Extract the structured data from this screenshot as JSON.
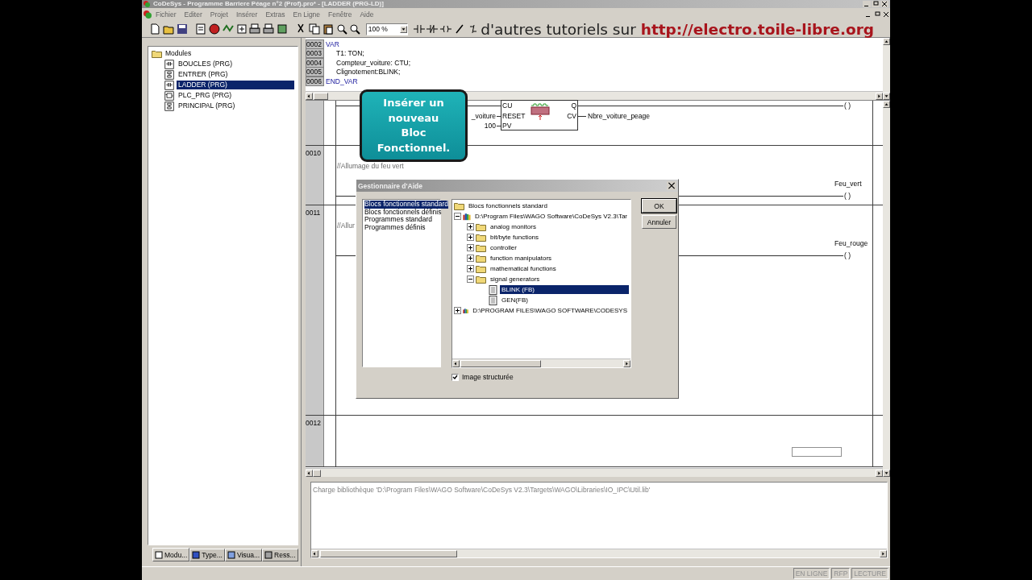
{
  "window": {
    "title": "CoDeSys - Programme Barriere Péage n°2 (Prof).pro* - [LADDER (PRG-LD)]"
  },
  "menu": [
    "Fichier",
    "Editer",
    "Projet",
    "Insérer",
    "Extras",
    "En Ligne",
    "Fenêtre",
    "Aide"
  ],
  "toolbar": {
    "zoom": "100 %"
  },
  "banner": {
    "text": "d'autres tutoriels sur",
    "link": "http://electro.toile-libre.org"
  },
  "modules": {
    "root": "Modules",
    "items": [
      {
        "label": "BOUCLES (PRG)",
        "kind": "ld",
        "selected": false
      },
      {
        "label": "ENTRER (PRG)",
        "kind": "sfc",
        "selected": false
      },
      {
        "label": "LADDER (PRG)",
        "kind": "ld",
        "selected": true
      },
      {
        "label": "PLC_PRG (PRG)",
        "kind": "fbd",
        "selected": false
      },
      {
        "label": "PRINCIPAL (PRG)",
        "kind": "sfc",
        "selected": false
      }
    ]
  },
  "left_tabs": [
    {
      "label": "Modu...",
      "kind": "modules",
      "selected": true
    },
    {
      "label": "Type...",
      "kind": "types",
      "selected": false
    },
    {
      "label": "Visua...",
      "kind": "visu",
      "selected": false
    },
    {
      "label": "Ress...",
      "kind": "resources",
      "selected": false
    }
  ],
  "declarations": [
    {
      "line": "0002",
      "text": "VAR",
      "kind": "keyword"
    },
    {
      "line": "0003",
      "text": "T1: TON;",
      "kind": "code"
    },
    {
      "line": "0004",
      "text": "Compteur_voiture: CTU;",
      "kind": "code"
    },
    {
      "line": "0005",
      "text": "Clignotement:BLINK;",
      "kind": "code"
    },
    {
      "line": "0006",
      "text": "END_VAR",
      "kind": "keyword"
    }
  ],
  "ladder": {
    "block": {
      "inputs": [
        "CU",
        "RESET",
        "PV"
      ],
      "outputs": [
        "Q",
        "CV"
      ],
      "input_vars": [
        "_voiture",
        "100"
      ],
      "output_var": "Nbre_voiture_peage",
      "coil": "( )"
    },
    "networks": [
      {
        "number": "0010",
        "comment": "//Allumage du feu vert",
        "coil_label": "Feu_vert",
        "coil": "( )"
      },
      {
        "number": "0011",
        "comment": "//Allur",
        "coil_label": "Feu_rouge",
        "coil": "( )"
      },
      {
        "number": "0012"
      }
    ]
  },
  "callout": {
    "text": "Insérer un nouveau Bloc Fonctionnel."
  },
  "dialog": {
    "title": "Gestionnaire d'Aide",
    "categories": [
      {
        "label": "Blocs fonctionnels standard",
        "selected": true
      },
      {
        "label": "Blocs fonctionnels définis",
        "selected": false
      },
      {
        "label": "Programmes standard",
        "selected": false
      },
      {
        "label": "Programmes définis",
        "selected": false
      }
    ],
    "tree": [
      {
        "label": "Blocs fonctionnels standard",
        "kind": "folder",
        "selected": false,
        "children": [
          {
            "label": "D:\\Program Files\\WAGO Software\\CoDeSys V2.3\\Tar",
            "kind": "library",
            "expanded": true,
            "selected": false,
            "children": [
              {
                "label": "analog monitors",
                "kind": "folder",
                "expanded": false,
                "selected": false
              },
              {
                "label": "bit/byte functions",
                "kind": "folder",
                "expanded": false,
                "selected": false
              },
              {
                "label": "controller",
                "kind": "folder",
                "expanded": false,
                "selected": false
              },
              {
                "label": "function manipulators",
                "kind": "folder",
                "expanded": false,
                "selected": false
              },
              {
                "label": "mathematical functions",
                "kind": "folder",
                "expanded": false,
                "selected": false
              },
              {
                "label": "signal generators",
                "kind": "folder",
                "expanded": true,
                "selected": false,
                "children": [
                  {
                    "label": "BLINK (FB)",
                    "kind": "block",
                    "selected": true
                  },
                  {
                    "label": "GEN(FB)",
                    "kind": "block",
                    "selected": false
                  }
                ]
              }
            ]
          },
          {
            "label": "D:\\PROGRAM FILES\\WAGO SOFTWARE\\CODESYS",
            "kind": "library",
            "expanded": false,
            "selected": false
          }
        ]
      }
    ],
    "buttons": [
      "OK",
      "Annuler"
    ],
    "structured": {
      "label": "Image structurée",
      "checked": true
    }
  },
  "messages": [
    "Charge bibliothèque 'D:\\Program Files\\WAGO Software\\CoDeSys V2.3\\Targets\\WAGO\\Libraries\\IO_IPC\\Util.lib'"
  ],
  "status": [
    "EN LIGNE",
    "RFP",
    "LECTURE"
  ]
}
